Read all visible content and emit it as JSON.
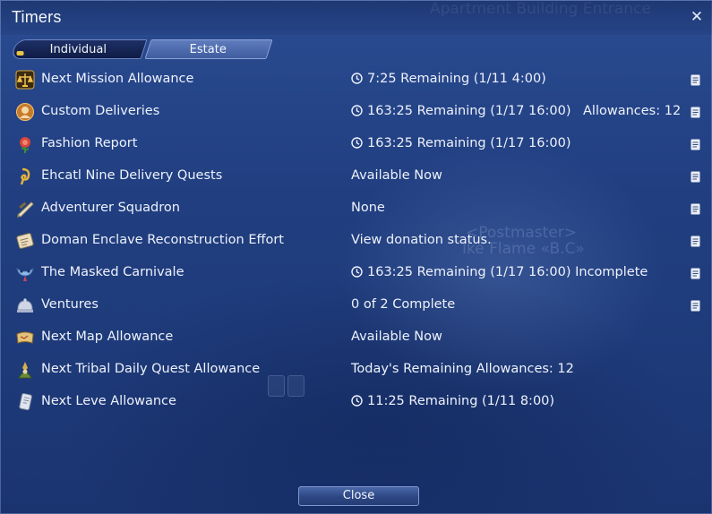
{
  "window": {
    "title": "Timers",
    "close_icon": "close-icon"
  },
  "background": {
    "ghost_top": "Apartment Building Entrance",
    "ghost_npc_title": "<Postmaster>",
    "ghost_npc_name": "Ike Flame «B.C»"
  },
  "tabs": [
    {
      "label": "Individual",
      "selected": true
    },
    {
      "label": "Estate",
      "selected": false
    }
  ],
  "rows": [
    {
      "icon": "mission-allowance-icon",
      "name": "Next Mission Allowance",
      "clock": true,
      "status": "7:25 Remaining  (1/11 4:00)",
      "extra": "",
      "note": true
    },
    {
      "icon": "custom-deliveries-icon",
      "name": "Custom Deliveries",
      "clock": true,
      "status": "163:25 Remaining  (1/17 16:00)",
      "extra": "Allowances: 12",
      "note": true
    },
    {
      "icon": "fashion-report-icon",
      "name": "Fashion Report",
      "clock": true,
      "status": "163:25 Remaining  (1/17 16:00)",
      "extra": "",
      "note": true
    },
    {
      "icon": "delivery-quests-icon",
      "name": "Ehcatl Nine Delivery Quests",
      "clock": false,
      "status": "Available Now",
      "extra": "",
      "note": true
    },
    {
      "icon": "adventurer-squadron-icon",
      "name": "Adventurer Squadron",
      "clock": false,
      "status": "None",
      "extra": "",
      "note": true
    },
    {
      "icon": "doman-enclave-icon",
      "name": "Doman Enclave Reconstruction Effort",
      "clock": false,
      "status": "View donation status.",
      "extra": "",
      "note": true
    },
    {
      "icon": "masked-carnivale-icon",
      "name": "The Masked Carnivale",
      "clock": true,
      "status": "163:25 Remaining  (1/17 16:00) Incomplete",
      "extra": "",
      "note": true
    },
    {
      "icon": "ventures-icon",
      "name": "Ventures",
      "clock": false,
      "status": "0 of 2 Complete",
      "extra": "",
      "note": true
    },
    {
      "icon": "map-allowance-icon",
      "name": "Next Map Allowance",
      "clock": false,
      "status": "Available Now",
      "extra": "",
      "note": false
    },
    {
      "icon": "tribal-quest-icon",
      "name": "Next Tribal Daily Quest Allowance",
      "clock": false,
      "status": "Today's Remaining Allowances: 12",
      "extra": "",
      "note": false
    },
    {
      "icon": "leve-allowance-icon",
      "name": "Next Leve Allowance",
      "clock": true,
      "status": "11:25 Remaining  (1/11 8:00)",
      "extra": "",
      "note": false
    }
  ],
  "footer": {
    "close_label": "Close"
  },
  "colors": {
    "accent": "#e8c545",
    "panel": "#213f7e",
    "text": "#eef2fb"
  }
}
